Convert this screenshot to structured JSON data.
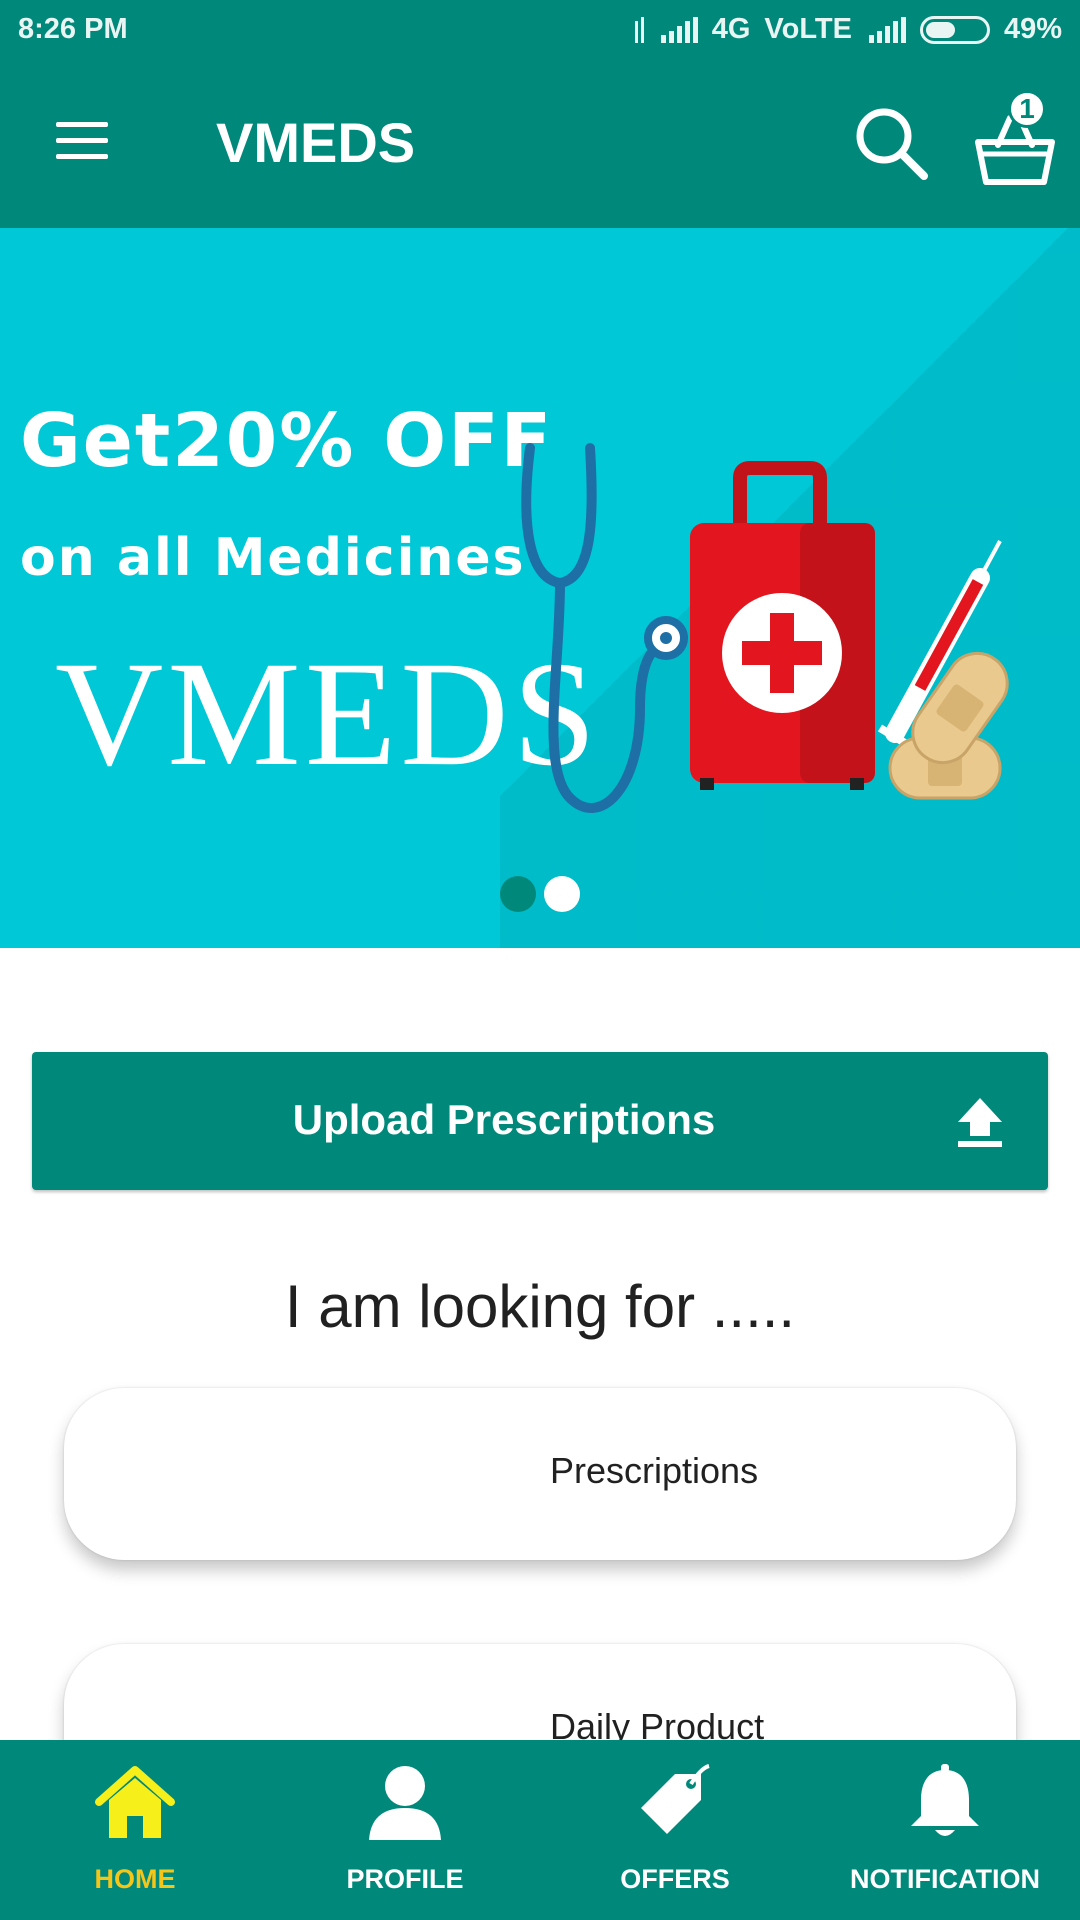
{
  "status_bar": {
    "time": "8:26 PM",
    "network": "4G",
    "volte": "VoLTE",
    "battery": "49%",
    "battery_level": 0.49
  },
  "app_bar": {
    "title": "VMEDS",
    "cart_count": "1"
  },
  "banner": {
    "line1": "Get20% OFF",
    "line2": "on all Medicines",
    "brand": "VMEDS",
    "slides": 2,
    "active_slide": 1
  },
  "upload": {
    "label": "Upload Prescriptions"
  },
  "section": {
    "heading": "I am looking for .....",
    "cards": [
      {
        "label": "Prescriptions"
      },
      {
        "label": "Daily Product"
      }
    ]
  },
  "bottom_nav": {
    "items": [
      {
        "label": "HOME",
        "icon": "home-icon",
        "active": true
      },
      {
        "label": "PROFILE",
        "icon": "profile-icon",
        "active": false
      },
      {
        "label": "OFFERS",
        "icon": "tag-icon",
        "active": false
      },
      {
        "label": "NOTIFICATION",
        "icon": "bell-icon",
        "active": false
      }
    ]
  },
  "colors": {
    "primary": "#00897b",
    "banner": "#00c8d6",
    "active_nav": "#f5c518",
    "dot_active": "#00897b",
    "dot_inactive": "#ffffff"
  }
}
